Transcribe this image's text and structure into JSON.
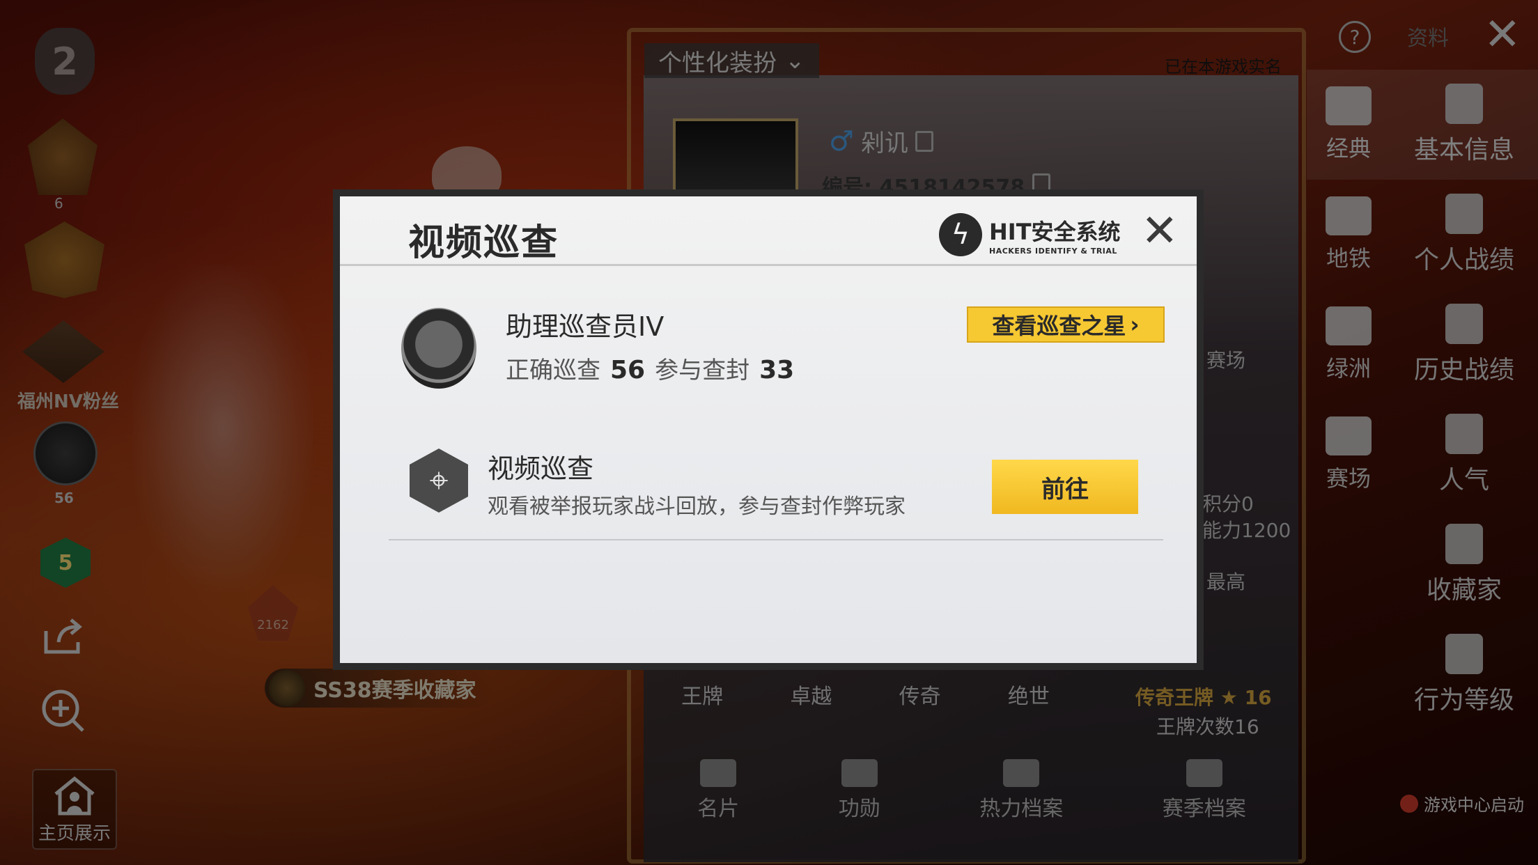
{
  "left": {
    "level": "2",
    "rank_sub": "6",
    "fan_label": "福州NV粉丝",
    "scope_value": "56",
    "green_badge": "5",
    "rating_value": "2162",
    "home_label": "主页展示"
  },
  "scene": {
    "season_tag": "SS38赛季收藏家"
  },
  "profile": {
    "customize_label": "个性化装扮",
    "realname_note": "已在本游戏实名",
    "player_name": "剁讥",
    "player_id": "编号: 4518142578",
    "side_texts": [
      "赛场",
      "积分0",
      "能力1200",
      "最高"
    ],
    "tiers": [
      "王牌",
      "卓越",
      "传奇",
      "绝世"
    ],
    "legend_info": "传奇王牌 ★ 16",
    "legend_count": "王牌次数16",
    "bottom_tabs": [
      "名片",
      "功勋",
      "热力档案",
      "赛季档案"
    ]
  },
  "topbar": {
    "help": "?",
    "label": "资料",
    "close": "✕"
  },
  "sidebar_modes": [
    "经典",
    "地铁",
    "绿洲",
    "赛场"
  ],
  "sidebar_main": [
    "基本信息",
    "个人战绩",
    "历史战绩",
    "人气",
    "收藏家",
    "行为等级"
  ],
  "game_center": "游戏中心启动",
  "modal": {
    "title": "视频巡查",
    "brand": "HIT安全系统",
    "brand_sub": "HACKERS IDENTIFY & TRIAL",
    "close": "✕",
    "rank_title": "助理巡查员IV",
    "stat1_label": "正确巡查",
    "stat1_value": "56",
    "stat2_label": "参与查封",
    "stat2_value": "33",
    "star_button": "查看巡查之星",
    "item_title": "视频巡查",
    "item_desc": "观看被举报玩家战斗回放，参与查封作弊玩家",
    "go_button": "前往"
  },
  "colors": {
    "accent_yellow": "#f6c832",
    "modal_bg": "#f2f2f2",
    "male_blue": "#4ea0e8"
  }
}
